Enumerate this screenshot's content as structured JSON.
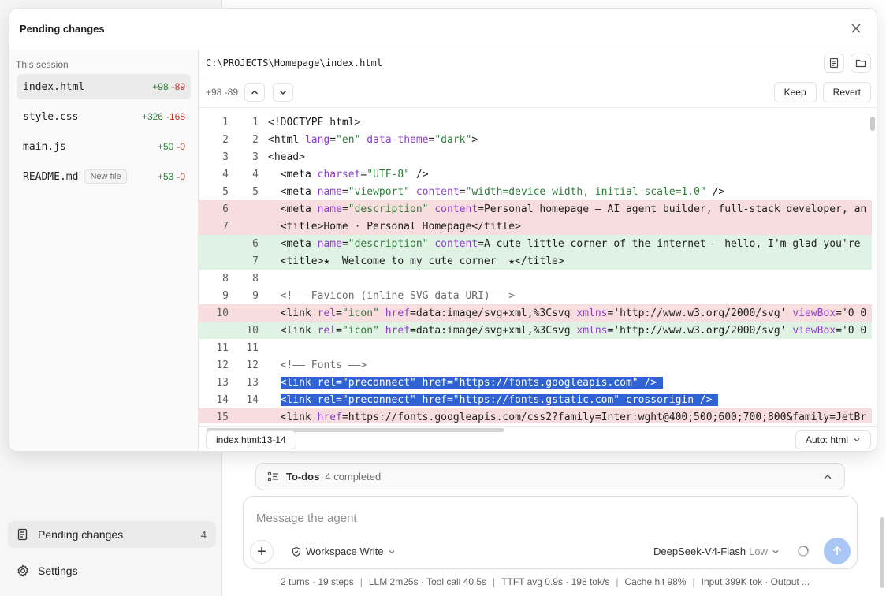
{
  "sidebar": {
    "pending_label": "Pending changes",
    "pending_count": "4",
    "settings_label": "Settings"
  },
  "todos": {
    "label": "To-dos",
    "summary": "4 completed"
  },
  "composer": {
    "placeholder": "Message the agent",
    "mode": "Workspace Write",
    "model": "DeepSeek-V4-Flash",
    "level": "Low"
  },
  "status": {
    "turns": "2 turns · 19 steps",
    "llm": "LLM 2m25s · Tool call 40.5s",
    "ttft": "TTFT avg 0.9s · 198 tok/s",
    "cache": "Cache hit 98%",
    "tokens": "Input 399K tok · Output ..."
  },
  "modal": {
    "title": "Pending changes",
    "section": "This session",
    "files": [
      {
        "name": "index.html",
        "add": "+98",
        "del": "-89",
        "badge": ""
      },
      {
        "name": "style.css",
        "add": "+326",
        "del": "-168",
        "badge": ""
      },
      {
        "name": "main.js",
        "add": "+50",
        "del": "-0",
        "badge": ""
      },
      {
        "name": "README.md",
        "add": "+53",
        "del": "-0",
        "badge": "New file"
      }
    ],
    "path": "C:\\PROJECTS\\Homepage\\index.html",
    "diffstat": "+98 -89",
    "keep": "Keep",
    "revert": "Revert",
    "selection_range": "index.html:13-14",
    "language": "Auto: html"
  },
  "code_lines": [
    {
      "old": "1",
      "new": "1",
      "kind": "ctx",
      "text": "<!DOCTYPE html>"
    },
    {
      "old": "2",
      "new": "2",
      "kind": "ctx",
      "text": "<html lang=\"en\" data-theme=\"dark\">"
    },
    {
      "old": "3",
      "new": "3",
      "kind": "ctx",
      "text": "<head>"
    },
    {
      "old": "4",
      "new": "4",
      "kind": "ctx",
      "text": "  <meta charset=\"UTF-8\" />"
    },
    {
      "old": "5",
      "new": "5",
      "kind": "ctx",
      "text": "  <meta name=\"viewport\" content=\"width=device-width, initial-scale=1.0\" />"
    },
    {
      "old": "6",
      "new": "",
      "kind": "del",
      "text": "  <meta name=\"description\" content=\"Personal homepage — AI agent builder, full-stack developer, an"
    },
    {
      "old": "7",
      "new": "",
      "kind": "del",
      "text": "  <title>Home · Personal Homepage</title>"
    },
    {
      "old": "",
      "new": "6",
      "kind": "add",
      "text": "  <meta name=\"description\" content=\"A cute little corner of the internet — hello, I'm glad you're"
    },
    {
      "old": "",
      "new": "7",
      "kind": "add",
      "text": "  <title>★  Welcome to my cute corner  ★</title>"
    },
    {
      "old": "8",
      "new": "8",
      "kind": "ctx",
      "text": ""
    },
    {
      "old": "9",
      "new": "9",
      "kind": "ctx",
      "text": "  <!—— Favicon (inline SVG data URI) ——>"
    },
    {
      "old": "10",
      "new": "",
      "kind": "del",
      "text": "  <link rel=\"icon\" href=\"data:image/svg+xml,%3Csvg xmlns='http://www.w3.org/2000/svg' viewBox='0 0"
    },
    {
      "old": "",
      "new": "10",
      "kind": "add",
      "text": "  <link rel=\"icon\" href=\"data:image/svg+xml,%3Csvg xmlns='http://www.w3.org/2000/svg' viewBox='0 0"
    },
    {
      "old": "11",
      "new": "11",
      "kind": "ctx",
      "text": ""
    },
    {
      "old": "12",
      "new": "12",
      "kind": "ctx",
      "text": "  <!—— Fonts ——>"
    },
    {
      "old": "13",
      "new": "13",
      "kind": "sel",
      "text": "  <link rel=\"preconnect\" href=\"https://fonts.googleapis.com\" />"
    },
    {
      "old": "14",
      "new": "14",
      "kind": "sel",
      "text": "  <link rel=\"preconnect\" href=\"https://fonts.gstatic.com\" crossorigin />"
    },
    {
      "old": "15",
      "new": "",
      "kind": "del",
      "text": "  <link href=\"https://fonts.googleapis.com/css2?family=Inter:wght@400;500;600;700;800&family=JetBr"
    }
  ]
}
